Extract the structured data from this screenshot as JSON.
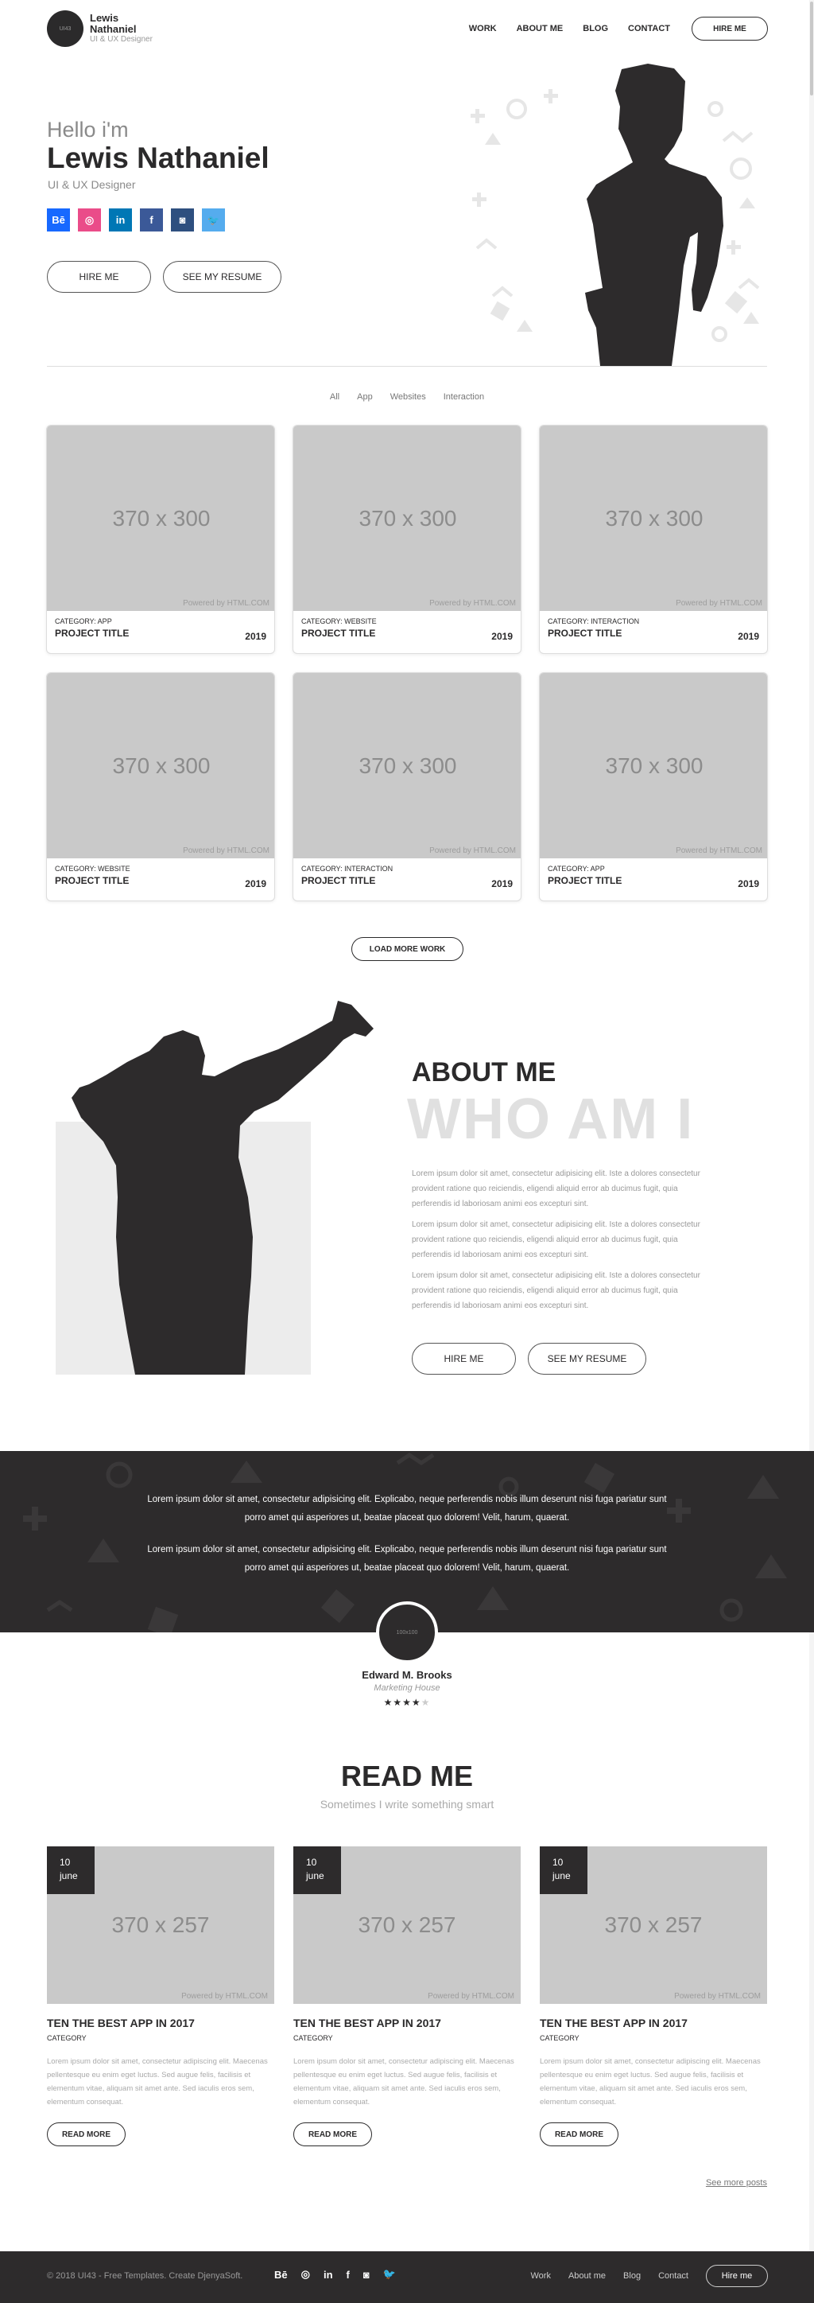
{
  "header": {
    "logo_mark": "UI43",
    "logo_name": "Lewis Nathaniel",
    "logo_sub": "UI & UX Designer",
    "nav": [
      "WORK",
      "ABOUT ME",
      "BLOG",
      "CONTACT"
    ],
    "hire_button": "HIRE ME"
  },
  "hero": {
    "hello": "Hello i'm",
    "name": "Lewis Nathaniel",
    "role": "UI & UX Designer",
    "socials": [
      {
        "icon": "behance-icon",
        "glyph": "Bē",
        "color": "#1769ff"
      },
      {
        "icon": "dribbble-icon",
        "glyph": "◎",
        "color": "#ea4c89"
      },
      {
        "icon": "linkedin-icon",
        "glyph": "in",
        "color": "#0077b5"
      },
      {
        "icon": "facebook-icon",
        "glyph": "f",
        "color": "#3b5998"
      },
      {
        "icon": "instagram-icon",
        "glyph": "◙",
        "color": "#2e4f7f"
      },
      {
        "icon": "twitter-icon",
        "glyph": "🐦",
        "color": "#55acee"
      }
    ],
    "hire_button": "HIRE ME",
    "resume_button": "SEE MY RESUME"
  },
  "filters": [
    "All",
    "App",
    "Websites",
    "Interaction"
  ],
  "portfolio": [
    {
      "placeholder": "370 x 300",
      "powered": "Powered by HTML.COM",
      "category": "CATEGORY: APP",
      "title": "PROJECT TITLE",
      "year": "2019"
    },
    {
      "placeholder": "370 x 300",
      "powered": "Powered by HTML.COM",
      "category": "CATEGORY: WEBSITE",
      "title": "PROJECT TITLE",
      "year": "2019"
    },
    {
      "placeholder": "370 x 300",
      "powered": "Powered by HTML.COM",
      "category": "CATEGORY: INTERACTION",
      "title": "PROJECT TITLE",
      "year": "2019"
    },
    {
      "placeholder": "370 x 300",
      "powered": "Powered by HTML.COM",
      "category": "CATEGORY: WEBSITE",
      "title": "PROJECT TITLE",
      "year": "2019"
    },
    {
      "placeholder": "370 x 300",
      "powered": "Powered by HTML.COM",
      "category": "CATEGORY: INTERACTION",
      "title": "PROJECT TITLE",
      "year": "2019"
    },
    {
      "placeholder": "370 x 300",
      "powered": "Powered by HTML.COM",
      "category": "CATEGORY: APP",
      "title": "PROJECT TITLE",
      "year": "2019"
    }
  ],
  "load_more": "LOAD MORE WORK",
  "about": {
    "title": "ABOUT ME",
    "big": "WHO AM I",
    "paragraphs": [
      "Lorem ipsum dolor sit amet, consectetur adipisicing elit. Iste a dolores consectetur provident ratione quo reiciendis, eligendi aliquid error ab ducimus fugit, quia perferendis id laboriosam animi eos excepturi sint.",
      "Lorem ipsum dolor sit amet, consectetur adipisicing elit. Iste a dolores consectetur provident ratione quo reiciendis, eligendi aliquid error ab ducimus fugit, quia perferendis id laboriosam animi eos excepturi sint.",
      "Lorem ipsum dolor sit amet, consectetur adipisicing elit. Iste a dolores consectetur provident ratione quo reiciendis, eligendi aliquid error ab ducimus fugit, quia perferendis id laboriosam animi eos excepturi sint."
    ],
    "hire_button": "HIRE ME",
    "resume_button": "SEE MY RESUME"
  },
  "testimonial": {
    "quotes": [
      "Lorem ipsum dolor sit amet, consectetur adipisicing elit. Explicabo, neque perferendis nobis illum deserunt nisi fuga pariatur sunt porro amet qui asperiores ut, beatae placeat quo dolorem! Velit, harum, quaerat.",
      "Lorem ipsum dolor sit amet, consectetur adipisicing elit. Explicabo, neque perferendis nobis illum deserunt nisi fuga pariatur sunt porro amet qui asperiores ut, beatae placeat quo dolorem! Velit, harum, quaerat."
    ],
    "avatar_placeholder": "100x100",
    "name": "Edward M. Brooks",
    "company": "Marketing House",
    "rating": 4,
    "rating_max": 5
  },
  "blog": {
    "title": "READ ME",
    "subtitle": "Sometimes I write something smart",
    "posts": [
      {
        "day": "10",
        "month": "june",
        "placeholder": "370 x 257",
        "powered": "Powered by HTML.COM",
        "title": "TEN THE BEST APP IN 2017",
        "category": "CATEGORY",
        "text": "Lorem ipsum dolor sit amet, consectetur adipiscing elit. Maecenas pellentesque eu enim eget luctus. Sed augue felis, facilisis et elementum vitae, aliquam sit amet ante. Sed iaculis eros sem, elementum consequat.",
        "button": "READ MORE"
      },
      {
        "day": "10",
        "month": "june",
        "placeholder": "370 x 257",
        "powered": "Powered by HTML.COM",
        "title": "TEN THE BEST APP IN 2017",
        "category": "CATEGORY",
        "text": "Lorem ipsum dolor sit amet, consectetur adipiscing elit. Maecenas pellentesque eu enim eget luctus. Sed augue felis, facilisis et elementum vitae, aliquam sit amet ante. Sed iaculis eros sem, elementum consequat.",
        "button": "READ MORE"
      },
      {
        "day": "10",
        "month": "june",
        "placeholder": "370 x 257",
        "powered": "Powered by HTML.COM",
        "title": "TEN THE BEST APP IN 2017",
        "category": "CATEGORY",
        "text": "Lorem ipsum dolor sit amet, consectetur adipiscing elit. Maecenas pellentesque eu enim eget luctus. Sed augue felis, facilisis et elementum vitae, aliquam sit amet ante. Sed iaculis eros sem, elementum consequat.",
        "button": "READ MORE"
      }
    ],
    "see_more": "See more posts"
  },
  "footer": {
    "copyright": "© 2018 UI43 - Free Templates. Create DjenyaSoft.",
    "socials": [
      {
        "icon": "behance-icon",
        "glyph": "Bē"
      },
      {
        "icon": "dribbble-icon",
        "glyph": "◎"
      },
      {
        "icon": "linkedin-icon",
        "glyph": "in"
      },
      {
        "icon": "facebook-icon",
        "glyph": "f"
      },
      {
        "icon": "instagram-icon",
        "glyph": "◙"
      },
      {
        "icon": "twitter-icon",
        "glyph": "🐦"
      }
    ],
    "nav": [
      "Work",
      "About me",
      "Blog",
      "Contact"
    ],
    "hire_button": "Hire me"
  },
  "colors": {
    "dark": "#2d2b2c",
    "placeholder": "#c9c9c9",
    "muted": "#999999"
  }
}
